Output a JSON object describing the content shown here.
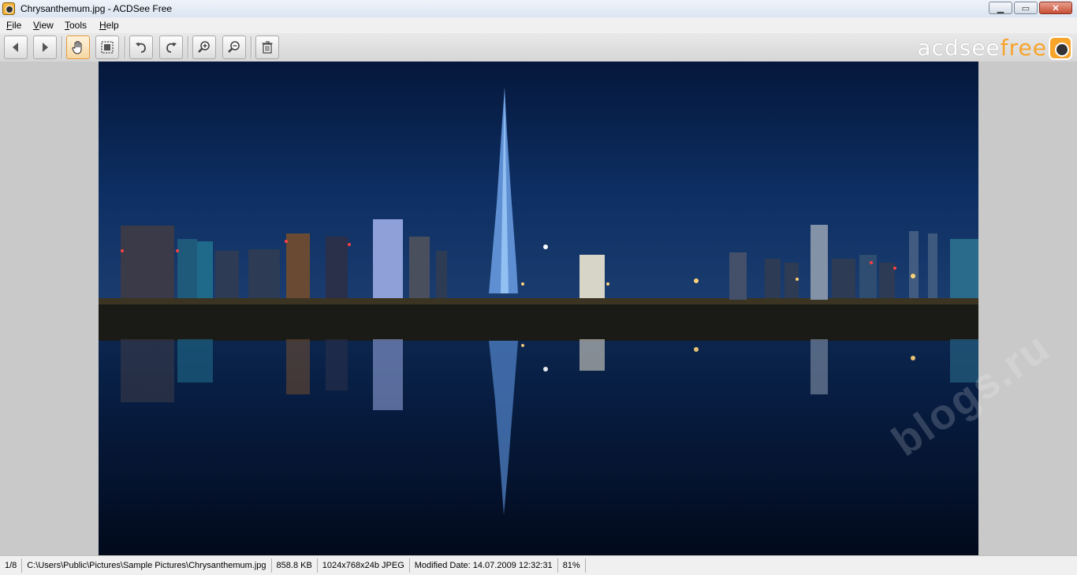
{
  "window": {
    "title": "Chrysanthemum.jpg - ACDSee Free",
    "controls": {
      "minimize": "▁",
      "maximize": "▭",
      "close": "✕"
    }
  },
  "menu": [
    {
      "accel": "F",
      "rest": "ile"
    },
    {
      "accel": "V",
      "rest": "iew"
    },
    {
      "accel": "T",
      "rest": "ools"
    },
    {
      "accel": "H",
      "rest": "elp"
    }
  ],
  "toolbar": {
    "buttons": [
      {
        "icon": "arrow-left-icon",
        "name": "previous-button"
      },
      {
        "icon": "arrow-right-icon",
        "name": "next-button"
      },
      {
        "icon": "hand-icon",
        "name": "pan-tool-button",
        "active": true
      },
      {
        "icon": "select-icon",
        "name": "select-tool-button"
      },
      {
        "icon": "rotate-left-icon",
        "name": "rotate-left-button"
      },
      {
        "icon": "rotate-right-icon",
        "name": "rotate-right-button"
      },
      {
        "icon": "zoom-in-icon",
        "name": "zoom-in-button"
      },
      {
        "icon": "zoom-out-icon",
        "name": "zoom-out-button"
      },
      {
        "icon": "trash-icon",
        "name": "delete-button"
      }
    ]
  },
  "brand": {
    "part1": "acdsee",
    "part2": "free",
    "accent": "#f7a42a"
  },
  "watermark": "blogs.ru",
  "status": {
    "index": "1/8",
    "path": "C:\\Users\\Public\\Pictures\\Sample Pictures\\Chrysanthemum.jpg",
    "size": "858.8 KB",
    "dimensions": "1024x768x24b JPEG",
    "modified": "Modified Date: 14.07.2009 12:32:31",
    "zoom": "81%"
  }
}
